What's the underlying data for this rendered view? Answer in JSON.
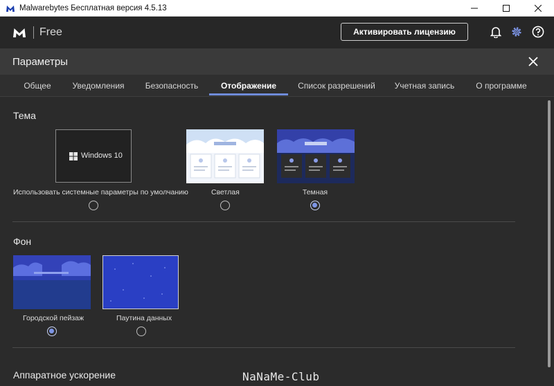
{
  "window": {
    "title": "Malwarebytes Бесплатная версия  4.5.13",
    "controls": [
      "minimize-icon",
      "maximize-icon",
      "close-icon"
    ]
  },
  "header": {
    "edition": "Free",
    "activate_label": "Активировать лицензию",
    "icons": [
      "bell-icon",
      "gear-icon",
      "help-icon"
    ],
    "accent": "#6f8bd9"
  },
  "settings": {
    "title": "Параметры",
    "tabs": [
      {
        "label": "Общее",
        "active": false
      },
      {
        "label": "Уведомления",
        "active": false
      },
      {
        "label": "Безопасность",
        "active": false
      },
      {
        "label": "Отображение",
        "active": true
      },
      {
        "label": "Список разрешений",
        "active": false
      },
      {
        "label": "Учетная запись",
        "active": false
      },
      {
        "label": "О программе",
        "active": false
      }
    ]
  },
  "theme": {
    "title": "Тема",
    "options": [
      {
        "label": "Использовать системные параметры по умолчанию",
        "thumb_text": "Windows 10",
        "selected": false
      },
      {
        "label": "Светлая",
        "selected": false
      },
      {
        "label": "Темная",
        "selected": true
      }
    ]
  },
  "background": {
    "title": "Фон",
    "options": [
      {
        "label": "Городской пейзаж",
        "selected": true
      },
      {
        "label": "Паутина данных",
        "selected": false
      }
    ]
  },
  "hardware": {
    "title": "Аппаратное ускорение"
  },
  "watermark": "NaNaMe-Club"
}
